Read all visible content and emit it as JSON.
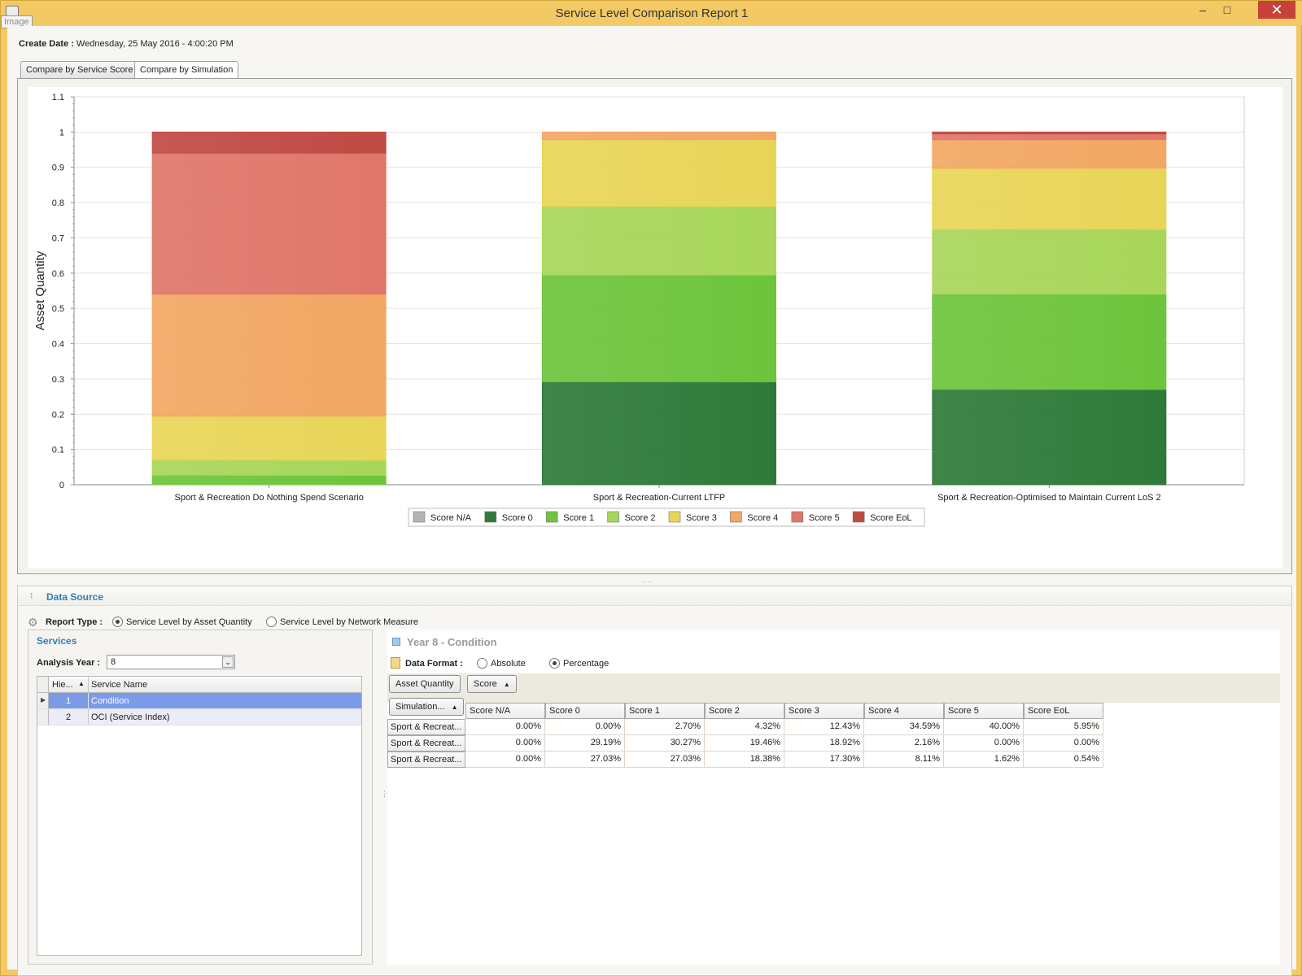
{
  "window": {
    "title": "Service Level Comparison Report 1",
    "tooltip": "Image",
    "minimize": "–",
    "maximize": "□",
    "close": "✕"
  },
  "create_date": {
    "label": "Create Date :",
    "value": "Wednesday, 25 May 2016 - 4:00:20 PM"
  },
  "tabs": [
    {
      "label": "Compare by Service Score",
      "active": false
    },
    {
      "label": "Compare by Simulation",
      "active": true
    }
  ],
  "chart_data": {
    "type": "bar",
    "stacked": true,
    "title": "",
    "ylabel": "Asset Quantity",
    "xlabel": "",
    "ylim": [
      0,
      1.1
    ],
    "yticks": [
      "0",
      "0.1",
      "0.2",
      "0.3",
      "0.4",
      "0.5",
      "0.6",
      "0.7",
      "0.8",
      "0.9",
      "1",
      "1.1"
    ],
    "grid": true,
    "legend_position": "bottom",
    "categories": [
      "Sport & Recreation Do Nothing Spend Scenario",
      "Sport & Recreation-Current LTFP",
      "Sport & Recreation-Optimised to Maintain Current LoS 2"
    ],
    "series": [
      {
        "name": "Score N/A",
        "color": "#b4b4b4",
        "values": [
          0.0,
          0.0,
          0.0
        ]
      },
      {
        "name": "Score 0",
        "color": "#2f7a3a",
        "values": [
          0.0,
          0.2919,
          0.2703
        ]
      },
      {
        "name": "Score 1",
        "color": "#6ec43c",
        "values": [
          0.027,
          0.3027,
          0.2703
        ]
      },
      {
        "name": "Score 2",
        "color": "#a8d65a",
        "values": [
          0.0432,
          0.1946,
          0.1838
        ]
      },
      {
        "name": "Score 3",
        "color": "#e8d558",
        "values": [
          0.1243,
          0.1892,
          0.173
        ]
      },
      {
        "name": "Score 4",
        "color": "#f2a764",
        "values": [
          0.3459,
          0.0216,
          0.0811
        ]
      },
      {
        "name": "Score 5",
        "color": "#e0766a",
        "values": [
          0.4,
          0.0,
          0.0162
        ]
      },
      {
        "name": "Score EoL",
        "color": "#c04a44",
        "values": [
          0.0595,
          0.0,
          0.0054
        ]
      }
    ]
  },
  "data_source": {
    "title": "Data Source",
    "report_type_label": "Report Type :",
    "report_type_options": [
      {
        "label": "Service Level by Asset Quantity",
        "selected": true
      },
      {
        "label": "Service Level by Network Measure",
        "selected": false
      }
    ]
  },
  "services": {
    "title": "Services",
    "analysis_year_label": "Analysis Year :",
    "analysis_year_value": "8",
    "columns": [
      "Hie...",
      "Service Name"
    ],
    "rows": [
      {
        "hier": "1",
        "name": "Condition",
        "selected": true
      },
      {
        "hier": "2",
        "name": "OCI (Service Index)",
        "selected": false
      }
    ]
  },
  "pivot": {
    "title": "Year 8 - Condition",
    "data_format_label": "Data Format :",
    "data_format_options": [
      {
        "label": "Absolute",
        "selected": false
      },
      {
        "label": "Percentage",
        "selected": true
      }
    ],
    "data_field_button": "Asset Quantity",
    "column_field_button": "Score",
    "row_field_button": "Simulation...",
    "columns": [
      "Score N/A",
      "Score 0",
      "Score 1",
      "Score 2",
      "Score 3",
      "Score 4",
      "Score 5",
      "Score EoL"
    ],
    "rows": [
      {
        "label": "Sport & Recreat...",
        "values": [
          "0.00%",
          "0.00%",
          "2.70%",
          "4.32%",
          "12.43%",
          "34.59%",
          "40.00%",
          "5.95%"
        ]
      },
      {
        "label": "Sport & Recreat...",
        "values": [
          "0.00%",
          "29.19%",
          "30.27%",
          "19.46%",
          "18.92%",
          "2.16%",
          "0.00%",
          "0.00%"
        ]
      },
      {
        "label": "Sport & Recreat...",
        "values": [
          "0.00%",
          "27.03%",
          "27.03%",
          "18.38%",
          "17.30%",
          "8.11%",
          "1.62%",
          "0.54%"
        ]
      }
    ]
  }
}
